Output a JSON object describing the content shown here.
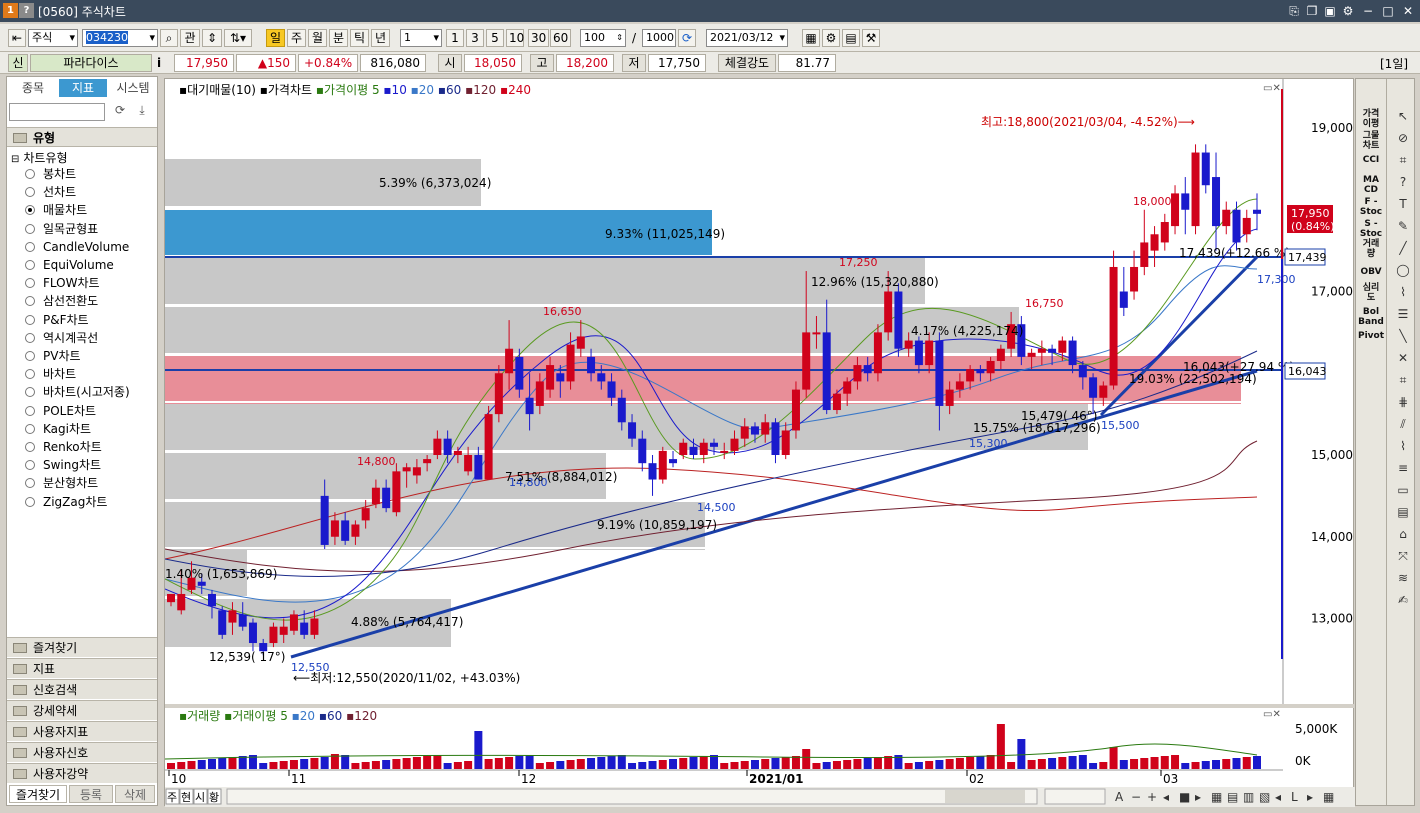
{
  "window": {
    "title": "[0560] 주식차트",
    "icon1": "1",
    "icon2": "?"
  },
  "toolbar": {
    "market": "주식",
    "code": "034230",
    "btn_gwan": "관",
    "periods": [
      "일",
      "주",
      "월",
      "분",
      "틱",
      "년"
    ],
    "period_num": "1",
    "intervals": [
      "1",
      "3",
      "5",
      "10",
      "30",
      "60"
    ],
    "count": "100",
    "slash": "/",
    "total": "1000",
    "date": "2021/03/12"
  },
  "quote": {
    "shin": "신",
    "name": "파라다이스",
    "info": "i",
    "price": "17,950",
    "change": "▲150",
    "pct": "+0.84%",
    "volume": "816,080",
    "open_label": "시",
    "open": "18,050",
    "high_label": "고",
    "high": "18,200",
    "low_label": "저",
    "low": "17,750",
    "strength_label": "체결강도",
    "strength": "81.77",
    "right_tag": "[1일]"
  },
  "left": {
    "tabs": [
      "종목",
      "지표",
      "시스템"
    ],
    "section": "유형",
    "tree_root": "차트유형",
    "chart_types": [
      "봉차트",
      "선차트",
      "매물차트",
      "일목균형표",
      "CandleVolume",
      "EquiVolume",
      "FLOW차트",
      "삼선전환도",
      "P&F차트",
      "역시계곡선",
      "PV차트",
      "바차트",
      "바차트(시고저종)",
      "POLE차트",
      "Kagi차트",
      "Renko차트",
      "Swing차트",
      "분산형차트",
      "ZigZag차트"
    ],
    "selected_index": 2,
    "accordion": [
      "즐겨찾기",
      "지표",
      "신호검색",
      "강세약세",
      "사용자지표",
      "사용자신호",
      "사용자강약"
    ],
    "bottom_tabs": [
      "즐겨찾기",
      "등록",
      "삭제"
    ]
  },
  "chart": {
    "legend": {
      "a": "대기매물(10)",
      "b": "가격차트",
      "c": "가격이평",
      "c_periods": [
        "5",
        "10",
        "20",
        "60",
        "120",
        "240"
      ]
    },
    "high_note": "최고:18,800(2021/03/04, -4.52%)⟶",
    "low_note": "⟵최저:12,550(2020/11/02, +43.03%)",
    "price_labels": [
      {
        "t": "18,000",
        "c": "#d0021b"
      },
      {
        "t": "17,250",
        "c": "#d0021b"
      },
      {
        "t": "16,750",
        "c": "#d0021b"
      },
      {
        "t": "16,650",
        "c": "#d0021b"
      },
      {
        "t": "14,800",
        "c": "#d0021b"
      },
      {
        "t": "14,800",
        "c": "#1a3fc0"
      },
      {
        "t": "14,500",
        "c": "#1a3fc0"
      },
      {
        "t": "15,300",
        "c": "#1a3fc0"
      },
      {
        "t": "15,500",
        "c": "#1a3fc0"
      },
      {
        "t": "12,550",
        "c": "#1a3fc0"
      },
      {
        "t": "17,300",
        "c": "#1a3fc0"
      }
    ],
    "vp_labels": [
      "5.39% (6,373,024)",
      "9.33% (11,025,149)",
      "12.96% (15,320,880)",
      "4.17% (4,225,174)",
      "19.03% (22,502,194)",
      "15.75% (18,617,296)",
      "7.51% (8,884,012)",
      "9.19% (10,859,197)",
      "4.88% (5,764,417)",
      "1.40% (1,653,869)"
    ],
    "trend_labels": [
      "12,539( 17°)",
      "15,479( 46°)",
      "17,439(+12.66 %)",
      "16,043(+27.94 %)"
    ],
    "yaxis": [
      "19,000",
      "17,000",
      "15,000",
      "14,000",
      "13,000"
    ],
    "right_tags": {
      "price": "17,950",
      "pct": "(0.84%)",
      "line1": "17,439",
      "line2": "16,043"
    },
    "xaxis": [
      "10",
      "11",
      "12",
      "2021/01",
      "02",
      "03"
    ],
    "volume_legend": {
      "a": "거래량",
      "b": "거래이평",
      "periods": [
        "5",
        "20",
        "60",
        "120"
      ]
    },
    "vol_axis": [
      "5,000K",
      "0K"
    ],
    "bottom_btns": [
      "주",
      "현",
      "시",
      "황"
    ]
  },
  "right": {
    "items": [
      "가격\n이평",
      "그물\n차트",
      "CCI",
      "MA\nCD",
      "F -\nStoc",
      "S -\nStoc",
      "거래\n량",
      "OBV",
      "심리\n도",
      "Bol\nBand",
      "Pivot"
    ]
  },
  "colors": {
    "up": "#d0021b",
    "down": "#1a1acc",
    "vp_gray": "#c8c8c8",
    "vp_blue": "#3c98d0",
    "vp_red": "#e88e98",
    "trend": "#1a3fa8"
  }
}
